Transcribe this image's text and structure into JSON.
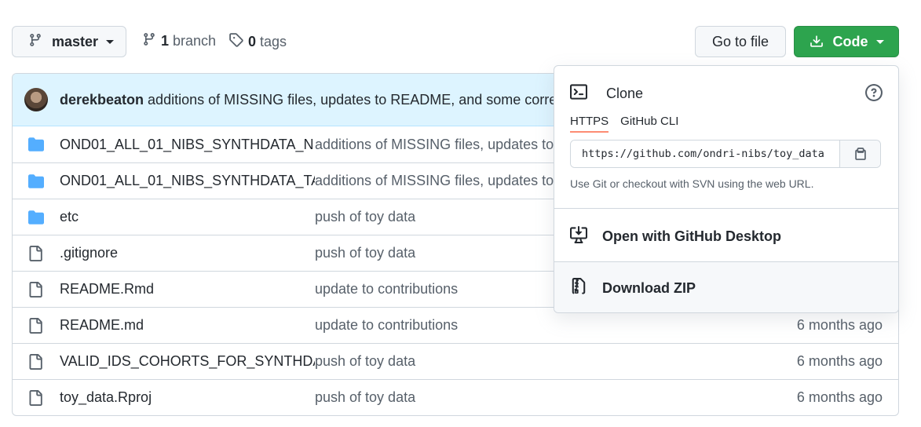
{
  "toolbar": {
    "branch_name": "master",
    "branch_count": "1",
    "branch_label": "branch",
    "tag_count": "0",
    "tag_label": "tags",
    "goto_file_label": "Go to file",
    "code_label": "Code"
  },
  "commit": {
    "author": "derekbeaton",
    "message": "additions of MISSING files, updates to README, and some corrections"
  },
  "files": [
    {
      "type": "folder",
      "name": "OND01_ALL_01_NIBS_SYNTHDATA_N...",
      "message": "additions of MISSING files, updates to README",
      "age": ""
    },
    {
      "type": "folder",
      "name": "OND01_ALL_01_NIBS_SYNTHDATA_TA...",
      "message": "additions of MISSING files, updates to README",
      "age": ""
    },
    {
      "type": "folder",
      "name": "etc",
      "message": "push of toy data",
      "age": ""
    },
    {
      "type": "file",
      "name": ".gitignore",
      "message": "push of toy data",
      "age": ""
    },
    {
      "type": "file",
      "name": "README.Rmd",
      "message": "update to contributions",
      "age": ""
    },
    {
      "type": "file",
      "name": "README.md",
      "message": "update to contributions",
      "age": "6 months ago"
    },
    {
      "type": "file",
      "name": "VALID_IDS_COHORTS_FOR_SYNTHDA...",
      "message": "push of toy data",
      "age": "6 months ago"
    },
    {
      "type": "file",
      "name": "toy_data.Rproj",
      "message": "push of toy data",
      "age": "6 months ago"
    }
  ],
  "clone_dropdown": {
    "title": "Clone",
    "tabs": [
      "HTTPS",
      "GitHub CLI"
    ],
    "active_tab": "HTTPS",
    "url": "https://github.com/ondri-nibs/toy_data",
    "note": "Use Git or checkout with SVN using the web URL.",
    "desktop_label": "Open with GitHub Desktop",
    "download_label": "Download ZIP"
  },
  "colors": {
    "code_button": "#2da44e",
    "commit_bar": "#ddf4ff",
    "folder_icon": "#54aeff",
    "active_tab_underline": "#fd8c73"
  },
  "icons": {
    "branch": "git-branch-icon",
    "tag": "tag-icon",
    "download": "download-icon",
    "folder": "folder-icon",
    "file": "file-icon",
    "terminal": "terminal-icon",
    "help": "question-icon",
    "copy": "copy-icon",
    "desktop": "desktop-download-icon",
    "zip": "file-zip-icon"
  }
}
